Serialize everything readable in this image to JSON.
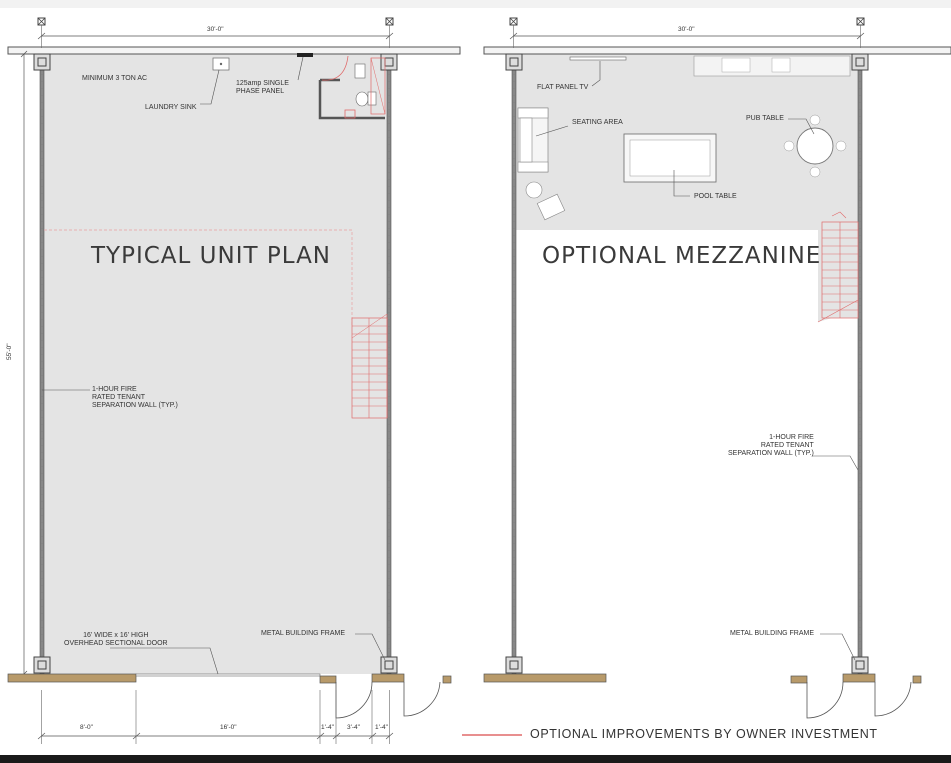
{
  "left_plan": {
    "title": "TYPICAL UNIT PLAN",
    "width_dim": "30'-0\"",
    "depth_dim": "55'-0\"",
    "notes": {
      "ac": "MINIMUM 3 TON AC",
      "laundry": "LAUNDRY SINK",
      "panel": "125amp SINGLE\nPHASE PANEL",
      "wall": "1-HOUR FIRE\nRATED TENANT\nSEPARATION WALL (TYP.)",
      "door": "16' WIDE x 16' HIGH\nOVERHEAD SECTIONAL DOOR",
      "frame": "METAL BUILDING FRAME"
    },
    "bottom_dims": [
      "8'-0\"",
      "16'-0\"",
      "1'-4\"",
      "3'-4\"",
      "1'-4\""
    ]
  },
  "right_plan": {
    "title": "OPTIONAL MEZZANINE",
    "width_dim": "30'-0\"",
    "notes": {
      "tv": "FLAT PANEL TV",
      "seating": "SEATING AREA",
      "pub": "PUB TABLE",
      "pool": "POOL TABLE",
      "wall": "1-HOUR FIRE\nRATED TENANT\nSEPARATION WALL (TYP.)",
      "frame": "METAL BUILDING FRAME"
    }
  },
  "legend": {
    "label": "OPTIONAL IMPROVEMENTS BY OWNER INVESTMENT",
    "color": "#e06a6a"
  },
  "colors": {
    "floor_fill": "#e4e4e4",
    "wall": "#555555",
    "optional": "#e06a6a",
    "footing": "#b89a6a"
  }
}
